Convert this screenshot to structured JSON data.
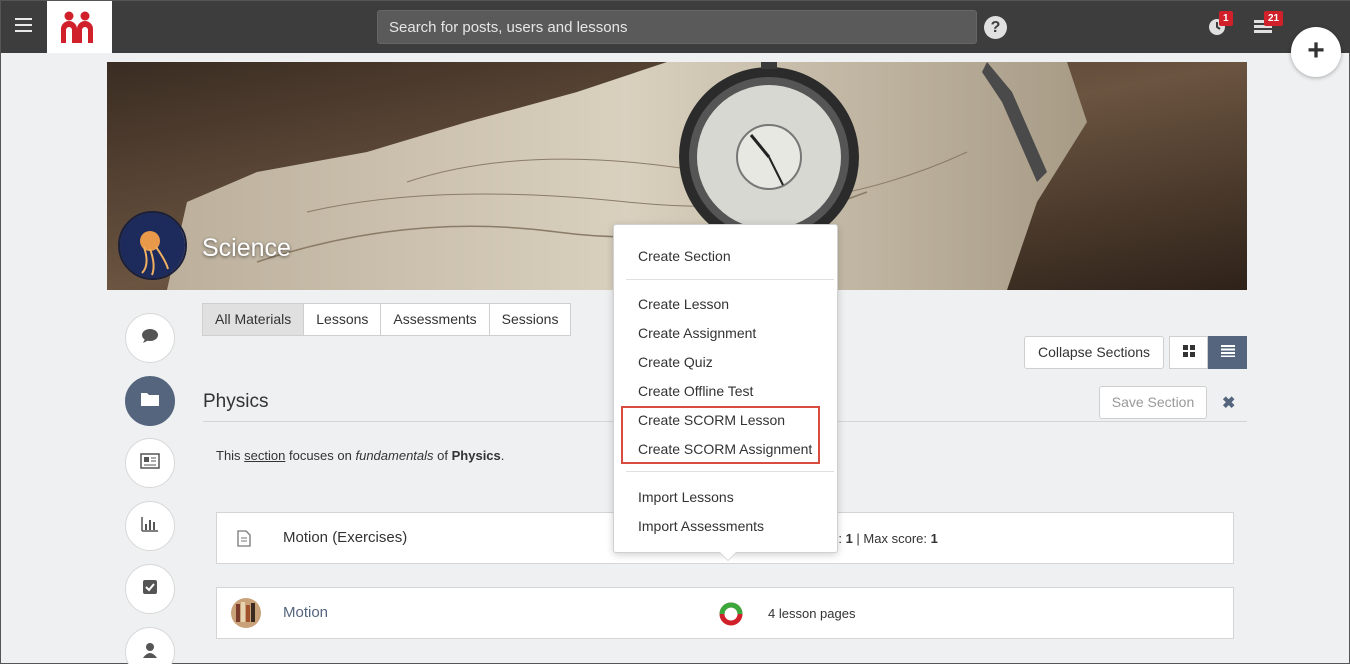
{
  "topbar": {
    "search_placeholder": "Search for posts, users and lessons",
    "help_label": "?",
    "notifications_count": "1",
    "tasks_count": "21",
    "create_label": "+"
  },
  "course": {
    "title": "Science"
  },
  "tabs": [
    {
      "label": "All Materials",
      "active": true
    },
    {
      "label": "Lessons",
      "active": false
    },
    {
      "label": "Assessments",
      "active": false
    },
    {
      "label": "Sessions",
      "active": false
    }
  ],
  "toolbar": {
    "collapse_label": "Collapse Sections",
    "save_section_label": "Save Section",
    "close_label": "✖"
  },
  "section": {
    "title": "Physics",
    "description": {
      "part1": "This ",
      "link": "section",
      "part2": " focuses on ",
      "emph": "fundamentals",
      "part3": " of ",
      "bold": "Physics",
      "part4": "."
    }
  },
  "rows": [
    {
      "name": "Motion (Exercises)",
      "meta_prefix": "pts: ",
      "attempts": "1",
      "separator": " | Max score: ",
      "max_score": "1"
    },
    {
      "name": "Motion",
      "meta": "4 lesson pages"
    }
  ],
  "menu": {
    "create_section": "Create Section",
    "create_lesson": "Create Lesson",
    "create_assignment": "Create Assignment",
    "create_quiz": "Create Quiz",
    "create_offline_test": "Create Offline Test",
    "create_scorm_lesson": "Create SCORM Lesson",
    "create_scorm_assignment": "Create SCORM Assignment",
    "import_lessons": "Import Lessons",
    "import_assessments": "Import Assessments"
  },
  "colors": {
    "accent": "#55657d",
    "brand_red": "#d0202a",
    "highlight": "#d84b3f",
    "topbar": "#3d3d3d"
  }
}
